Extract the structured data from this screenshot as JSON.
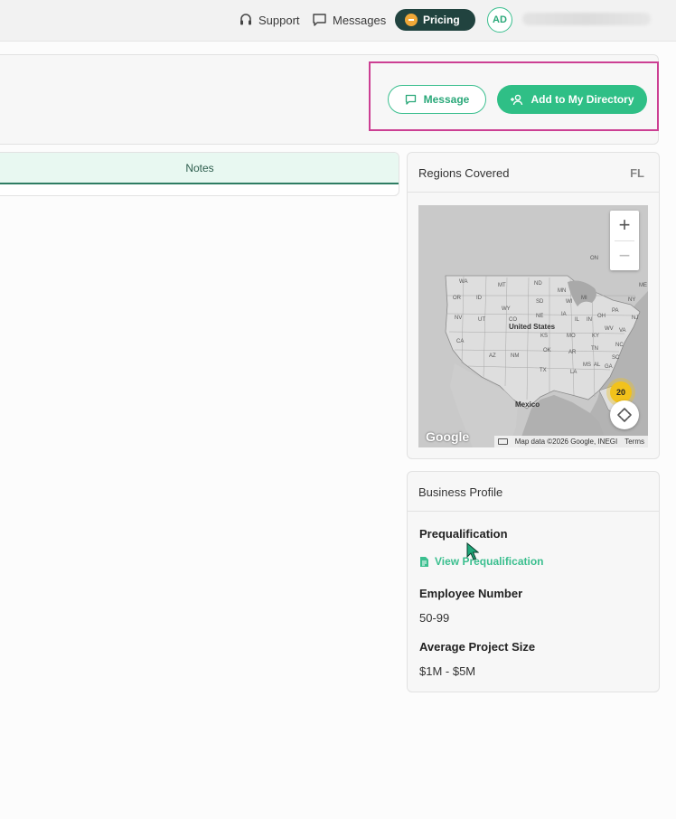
{
  "topbar": {
    "support_label": "Support",
    "messages_label": "Messages",
    "pricing_label": "Pricing",
    "avatar_initials": "AD"
  },
  "header": {
    "message_button_label": "Message",
    "add_directory_button_label": "Add to My Directory"
  },
  "tabs": {
    "notes_label": "Notes"
  },
  "regions": {
    "title": "Regions Covered",
    "code": "FL",
    "map": {
      "cluster_count": "20",
      "google_label": "Google",
      "attribution_text": "Map data ©2026 Google, INEGI",
      "terms_label": "Terms",
      "country_label_us": "United States",
      "country_label_mx": "Mexico",
      "state_labels": [
        "WA",
        "MT",
        "ND",
        "MN",
        "OR",
        "ID",
        "SD",
        "WI",
        "MI",
        "WY",
        "NE",
        "IA",
        "IL",
        "IN",
        "OH",
        "PA",
        "NY",
        "NV",
        "UT",
        "CO",
        "KS",
        "MO",
        "KY",
        "WV",
        "VA",
        "CA",
        "AZ",
        "NM",
        "OK",
        "AR",
        "TN",
        "NC",
        "SC",
        "TX",
        "LA",
        "MS",
        "AL",
        "GA",
        "FL",
        "ON",
        "ME",
        "NJ"
      ]
    }
  },
  "profile": {
    "title": "Business Profile",
    "prequal_label": "Prequalification",
    "prequal_link": "View Prequalification",
    "employee_label": "Employee Number",
    "employee_value": "50-99",
    "project_size_label": "Average Project Size",
    "project_size_value": "$1M - $5M"
  },
  "colors": {
    "accent": "#2fbf86",
    "highlight": "#cc3f93",
    "pricing_bg": "#21433f"
  }
}
